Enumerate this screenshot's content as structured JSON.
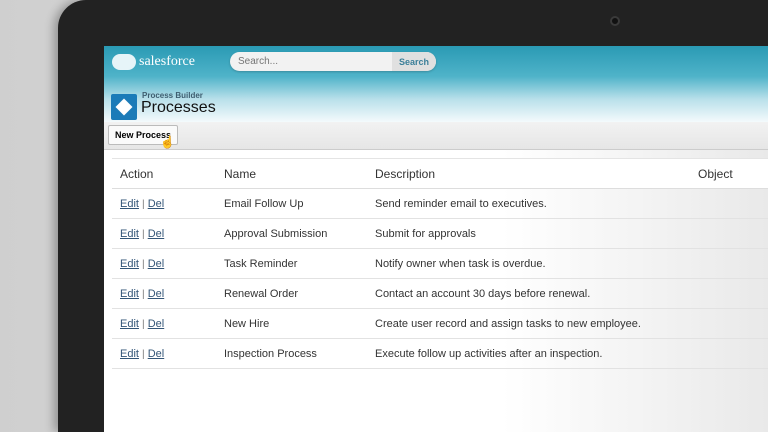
{
  "brand": "salesforce",
  "search": {
    "placeholder": "Search...",
    "button": "Search"
  },
  "page": {
    "subtitle": "Process Builder",
    "title": "Processes"
  },
  "toolbar": {
    "new_process": "New Process"
  },
  "table": {
    "columns": [
      "Action",
      "Name",
      "Description",
      "Object"
    ],
    "edit": "Edit",
    "sep": "|",
    "del": "Del",
    "rows": [
      {
        "name": "Email Follow Up",
        "description": "Send reminder email to executives."
      },
      {
        "name": "Approval Submission",
        "description": "Submit for approvals"
      },
      {
        "name": "Task Reminder",
        "description": "Notify owner when task is overdue."
      },
      {
        "name": "Renewal Order",
        "description": "Contact an account 30 days before renewal."
      },
      {
        "name": "New Hire",
        "description": "Create user record and assign tasks to new employee."
      },
      {
        "name": "Inspection Process",
        "description": "Execute follow up activities after an inspection."
      }
    ]
  }
}
